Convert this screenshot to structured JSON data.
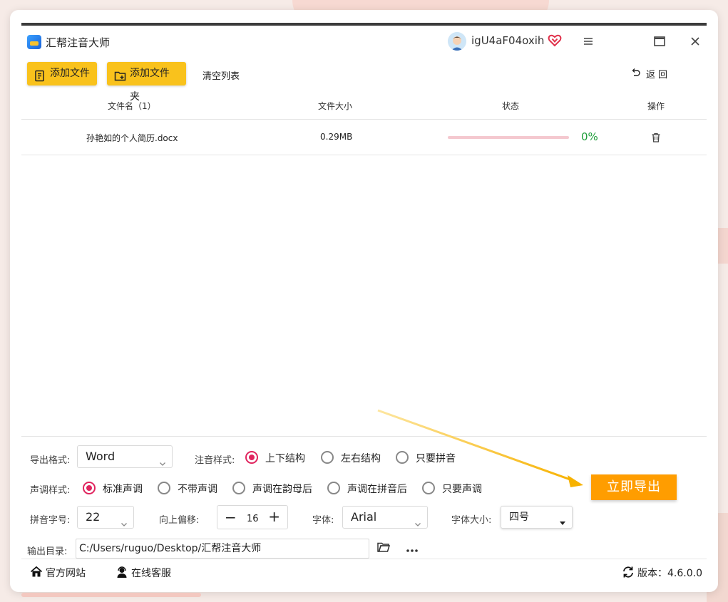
{
  "window": {
    "app_title": "汇帮注音大师",
    "user_name": "igU4aF04oxih"
  },
  "toolbar": {
    "add_file": "添加文件",
    "add_folder": "添加文件夹",
    "clear_list": "清空列表",
    "back": "返回"
  },
  "table": {
    "columns": [
      "文件名（1）",
      "文件大小",
      "状态",
      "操作"
    ],
    "rows": [
      {
        "name": "孙艳如的个人简历.docx",
        "size": "0.29MB",
        "progress_percent": 0,
        "status_text": "0%"
      }
    ]
  },
  "settings": {
    "export_format_label": "导出格式:",
    "export_format_value": "Word",
    "annotation_style_label": "注音样式:",
    "annotation_options": [
      "上下结构",
      "左右结构",
      "只要拼音"
    ],
    "annotation_selected": 0,
    "tone_style_label": "声调样式:",
    "tone_options": [
      "标准声调",
      "不带声调",
      "声调在韵母后",
      "声调在拼音后",
      "只要声调"
    ],
    "tone_selected": 0,
    "pinyin_size_label": "拼音字号:",
    "pinyin_size_value": "22",
    "offset_label": "向上偏移:",
    "offset_value": "16",
    "font_label": "字体:",
    "font_value": "Arial",
    "font_size_label": "字体大小:",
    "font_size_value": "四号",
    "output_dir_label": "输出目录:",
    "output_dir_value": "C:/Users/ruguo/Desktop/汇帮注音大师"
  },
  "actions": {
    "export_now": "立即导出"
  },
  "footer": {
    "official_site": "官方网站",
    "online_service": "在线客服",
    "version": "版本：4.6.0.0"
  },
  "colors": {
    "accent_yellow": "#f9c21c",
    "export_orange": "#ff9d00",
    "radio_active": "#e0245e",
    "progress_track": "#f4c8cf",
    "percent_green": "#1e9e3a"
  }
}
